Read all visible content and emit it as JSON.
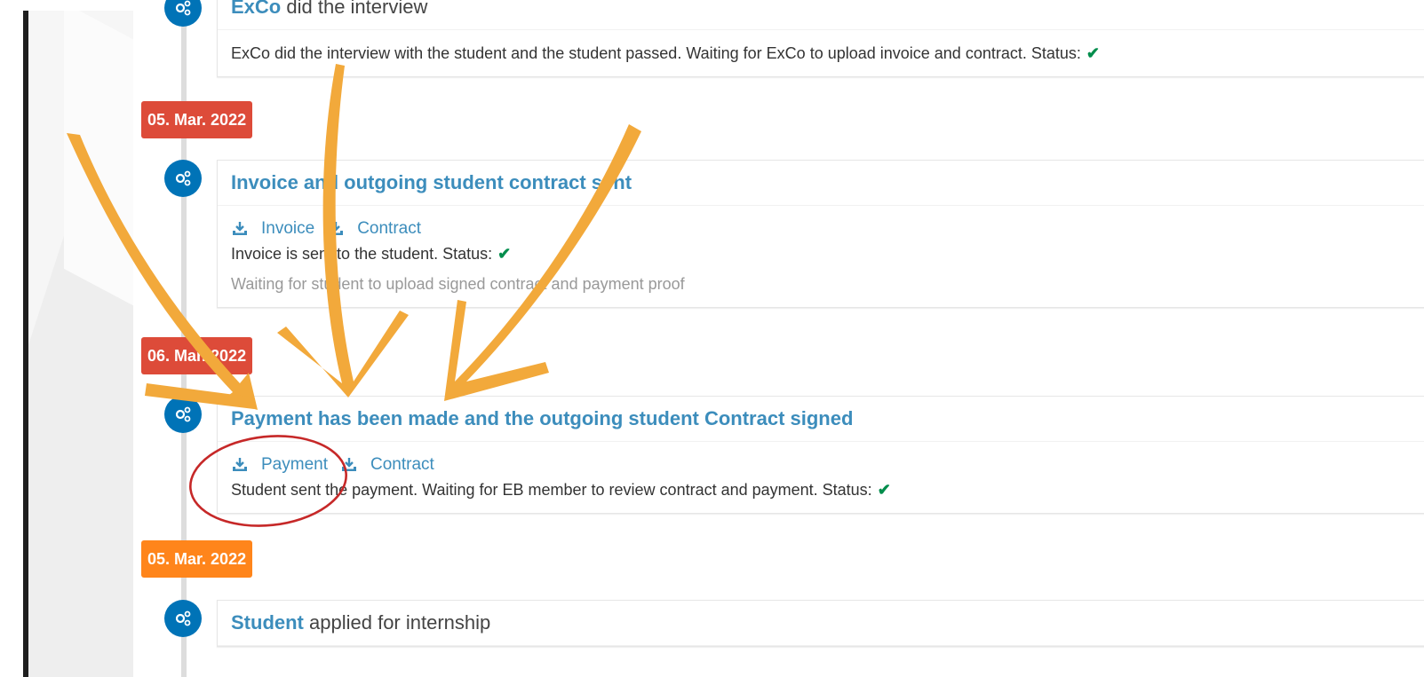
{
  "timeline": {
    "events": [
      {
        "header_actor": "ExCo",
        "header_text": "did the interview",
        "body": "ExCo did the interview with the student and the student passed. Waiting for ExCo to upload invoice and contract. Status:"
      },
      {
        "date": "05. Mar. 2022",
        "date_color": "#dd4b39",
        "title": "Invoice and outgoing student contract sent",
        "links": [
          "Invoice",
          "Contract"
        ],
        "body": "Invoice is sent to the student. Status:",
        "note": "Waiting for student to upload signed contract and payment proof"
      },
      {
        "date": "06. Mar. 2022",
        "date_color": "#dd4b39",
        "title": "Payment has been made and the outgoing student Contract signed",
        "links": [
          "Payment",
          "Contract"
        ],
        "body": "Student sent the payment. Waiting for EB member to review contract and payment. Status:"
      },
      {
        "date": "05. Mar. 2022",
        "date_color": "#ff851b",
        "header_actor": "Student",
        "header_text": "applied for internship"
      }
    ]
  },
  "icons": {
    "event": "gears-icon",
    "download": "download-icon",
    "status": "check-icon"
  },
  "colors": {
    "link": "#3c8dbc",
    "event_icon_bg": "#0073b7",
    "success": "#008d4c",
    "date_red": "#dd4b39",
    "date_orange": "#ff851b",
    "annotation_arrow": "#f2a93b",
    "annotation_circle": "#c62828"
  }
}
